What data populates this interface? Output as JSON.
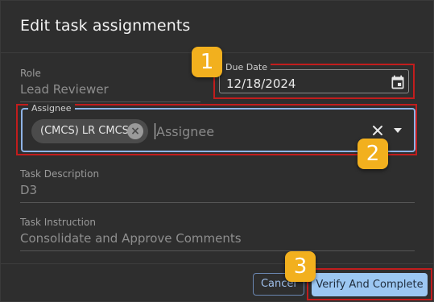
{
  "dialog": {
    "title": "Edit task assignments"
  },
  "role": {
    "label": "Role",
    "value": "Lead Reviewer"
  },
  "due_date": {
    "label": "Due Date",
    "value": "12/18/2024",
    "icon": "calendar-icon"
  },
  "assignee": {
    "label": "Assignee",
    "chip": "(CMCS) LR CMCS",
    "placeholder": "Assignee",
    "icons": [
      "close-icon",
      "chevron-down-icon"
    ]
  },
  "task_description": {
    "label": "Task Description",
    "value": "D3"
  },
  "task_instruction": {
    "label": "Task Instruction",
    "value": "Consolidate and Approve Comments"
  },
  "buttons": {
    "cancel": "Cancel",
    "verify": "Verify And Complete"
  },
  "badges": [
    "1",
    "2",
    "3"
  ],
  "colors": {
    "background": "#2e2e2e",
    "highlight": "#c21d1d",
    "badge": "#f2b01e",
    "primary_button": "#9cc7f2",
    "focus_border": "#8fb3e6"
  }
}
